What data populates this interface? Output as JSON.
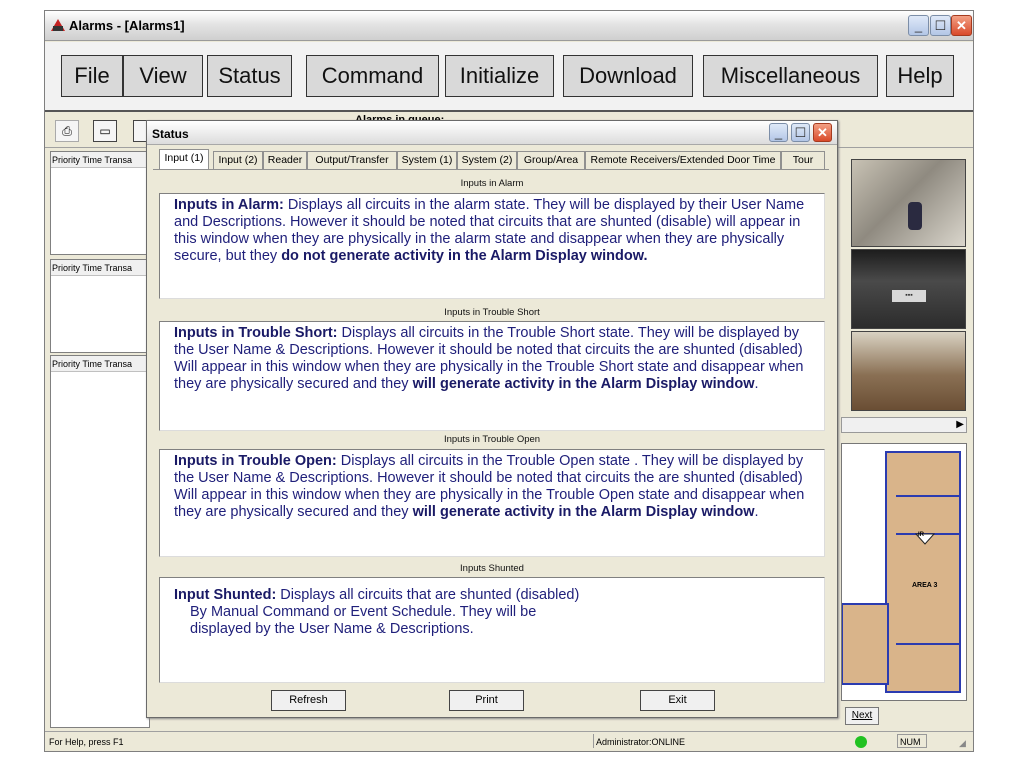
{
  "app": {
    "title": "Alarms - [Alarms1]",
    "menu": [
      "File",
      "View",
      "Status",
      "Command",
      "Initialize",
      "Download",
      "Miscellaneous",
      "Help"
    ],
    "toolbar": {
      "queue_label": "Alarms in queue:"
    },
    "panes": [
      {
        "columns": [
          "Priority",
          "Time",
          "Transa"
        ]
      },
      {
        "columns": [
          "Priority",
          "Time",
          "Transa"
        ]
      },
      {
        "columns": [
          "Priority",
          "Time",
          "Transa"
        ]
      }
    ],
    "map": {
      "area_label": "AREA 3",
      "ir_label": "IR"
    },
    "nav": {
      "next_label": "Next"
    },
    "statusbar": {
      "help": "For Help, press F1",
      "user": "Administrator:ONLINE",
      "num": "NUM",
      "indicator_color": "#22c222"
    }
  },
  "dialog": {
    "title": "Status",
    "tabs": [
      "Input (1)",
      "Input (2)",
      "Reader",
      "Output/Transfer",
      "System (1)",
      "System (2)",
      "Group/Area",
      "Remote Receivers/Extended Door Time",
      "Tour"
    ],
    "active_tab": "Input (1)",
    "sections": [
      {
        "header": "Inputs in Alarm",
        "lead": "Inputs in Alarm:",
        "text": " Displays all circuits in the alarm state. They will be displayed by their User Name and Descriptions. However it should be noted that circuits that are shunted (disable) will appear in this window when they are physically in the alarm state and disappear when they are physically secure, but they ",
        "emph": "do not generate activity in the Alarm Display window.",
        "tail": ""
      },
      {
        "header": "Inputs in Trouble Short",
        "lead": "Inputs in Trouble Short:",
        "text": " Displays all circuits in the Trouble Short state. They will be displayed by the User Name & Descriptions. However it should be noted that circuits the are shunted (disabled) Will appear in this window when they are physically in the Trouble Short state and disappear when they are physically secured and they ",
        "emph": "will generate activity in the Alarm Display window",
        "tail": "."
      },
      {
        "header": "Inputs in Trouble Open",
        "lead": "Inputs in Trouble Open:",
        "text": " Displays all circuits in the Trouble Open state . They will be displayed by the User Name & Descriptions. However it should be noted that circuits the are shunted (disabled) Will appear in this window when they are physically in the Trouble Open state and disappear when they are physically secured and they ",
        "emph": "will generate activity in the Alarm Display window",
        "tail": "."
      },
      {
        "header": "Inputs Shunted",
        "lead": "Input Shunted:",
        "text": " Displays all circuits that are shunted (disabled)",
        "line2": "By Manual Command or Event Schedule. They will be",
        "line3": "displayed by the User Name & Descriptions."
      }
    ],
    "buttons": {
      "refresh": "Refresh",
      "print": "Print",
      "exit": "Exit"
    }
  }
}
